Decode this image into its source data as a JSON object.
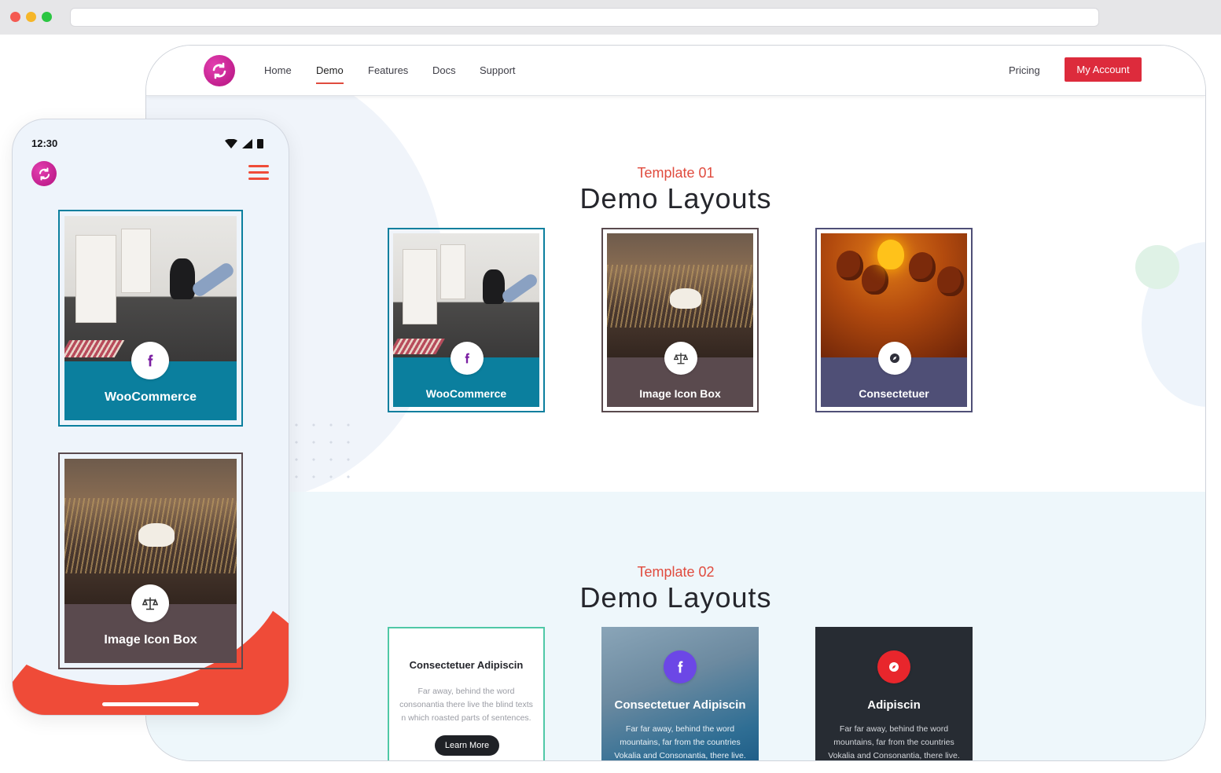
{
  "nav": {
    "links": [
      "Home",
      "Demo",
      "Features",
      "Docs",
      "Support"
    ],
    "active": "Demo",
    "pricing": "Pricing",
    "account_button": "My Account"
  },
  "section1": {
    "subtitle": "Template 01",
    "title": "Demo Layouts",
    "cards": [
      {
        "title": "WooCommerce",
        "icon": "facebook-icon",
        "band_color": "#0b7f9e",
        "border_color": "#0b7f9e"
      },
      {
        "title": "Image Icon Box",
        "icon": "scale-icon",
        "band_color": "#5a4a4e",
        "border_color": "#5a4a4e"
      },
      {
        "title": "Consectetuer",
        "icon": "compass-icon",
        "band_color": "#4f4f76",
        "border_color": "#4f4f76"
      }
    ]
  },
  "section2": {
    "subtitle": "Template 02",
    "title": "Demo Layouts",
    "cards": [
      {
        "title": "Consectetuer Adipiscin",
        "text": "Far away, behind the word consonantia there live the blind texts n which roasted parts of sentences.",
        "button": "Learn More"
      },
      {
        "title": "Consectetuer Adipiscin",
        "text": "Far far away, behind the word mountains, far from the countries Vokalia and Consonantia, there live.",
        "icon": "facebook-icon",
        "icon_color": "#6c47e6"
      },
      {
        "title": "Adipiscin",
        "text": "Far far away, behind the word mountains, far from the countries Vokalia and Consonantia, there live.",
        "icon": "compass-icon",
        "icon_color": "#e8262c"
      }
    ]
  },
  "mobile": {
    "time": "12:30",
    "cards": [
      {
        "title": "WooCommerce",
        "icon": "facebook-icon",
        "band_color": "#0b7f9e"
      },
      {
        "title": "Image Icon Box",
        "icon": "scale-icon",
        "band_color": "#5a4a4e"
      }
    ]
  },
  "colors": {
    "accent": "#e04b3e",
    "brand": "#c21d8f",
    "button": "#dd2b3c"
  }
}
